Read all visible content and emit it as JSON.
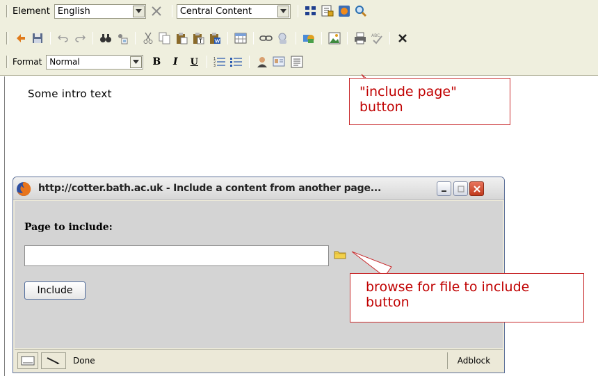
{
  "toolbar": {
    "row1": {
      "element_label": "Element",
      "element_value": "English",
      "location_value": "Central Content",
      "icons": [
        "remove-icon",
        "blocks-icon",
        "page-properties-icon",
        "firefox-preview-icon",
        "search-icon"
      ]
    },
    "row2": {
      "icons": [
        "paste-swap-icon",
        "save-icon",
        "undo-icon",
        "redo-icon",
        "find-icon",
        "replace-icon",
        "cut-icon",
        "copy-icon",
        "paste-icon",
        "paste-text-icon",
        "paste-word-icon",
        "table-icon",
        "link-icon",
        "unlink-icon",
        "image-gallery-icon",
        "image-icon",
        "print-icon",
        "spellcheck-icon",
        "delete-icon"
      ]
    },
    "row3": {
      "format_label": "Format",
      "format_value": "Normal",
      "bold": "B",
      "italic": "I",
      "underline": "U",
      "icons": [
        "ordered-list-icon",
        "unordered-list-icon",
        "person-icon",
        "contact-card-icon",
        "include-page-icon"
      ]
    }
  },
  "content": {
    "intro_text": "Some intro text"
  },
  "callouts": {
    "include_page": {
      "line1": "\"include page\"",
      "line2": "button"
    },
    "browse": {
      "line1": "browse for file to include",
      "line2": "button"
    }
  },
  "popup": {
    "title": "http://cotter.bath.ac.uk - Include a content from another page...",
    "field_label": "Page to include:",
    "field_value": "",
    "include_button": "Include",
    "status_text": "Done",
    "status_right": "Adblock"
  },
  "colors": {
    "toolbar_bg": "#efefde",
    "callout_red": "#c00000",
    "popup_body": "#d4d4d4"
  }
}
